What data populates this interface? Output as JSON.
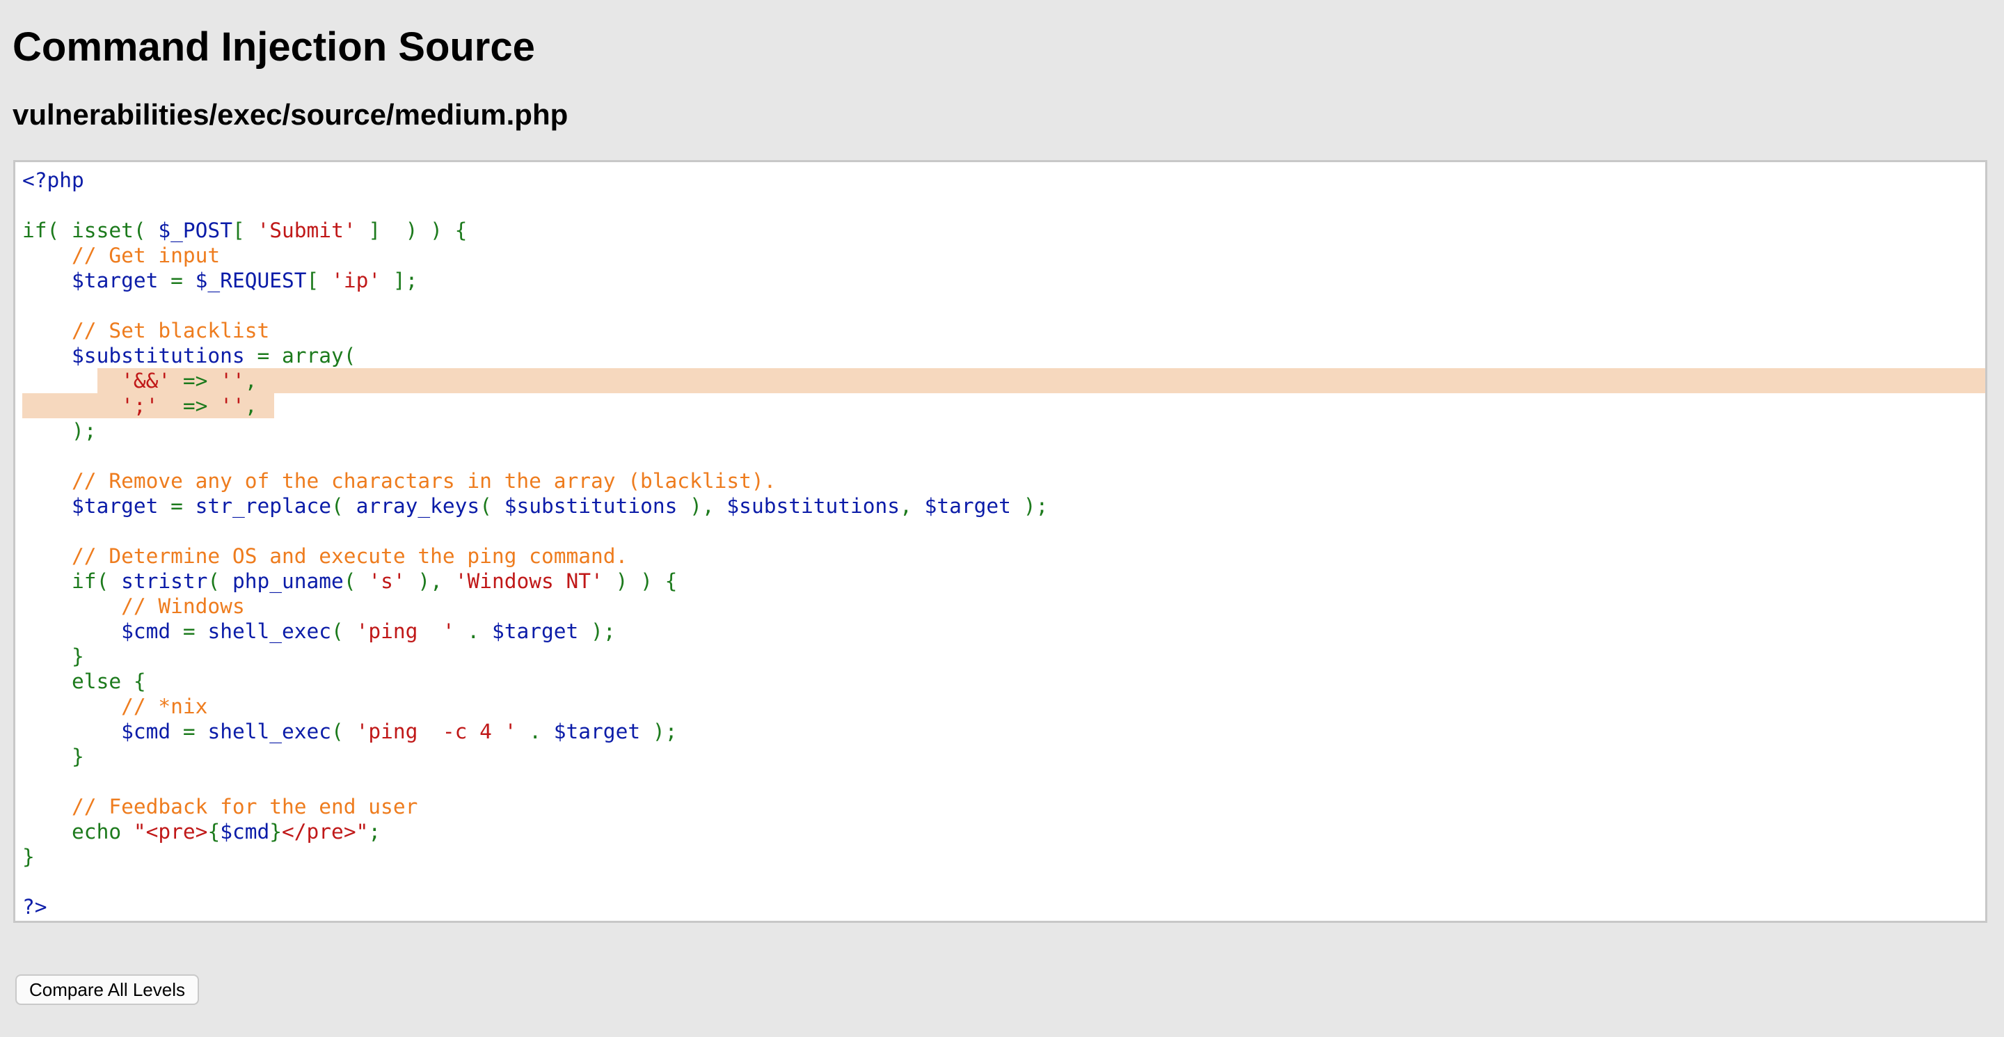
{
  "page": {
    "title": "Command Injection Source",
    "file_path": "vulnerabilities/exec/source/medium.php"
  },
  "code_lines": [
    [
      {
        "t": "<?php",
        "c": "v"
      }
    ],
    [],
    [
      {
        "t": "if( ",
        "c": "k"
      },
      {
        "t": "isset",
        "c": "k"
      },
      {
        "t": "( ",
        "c": "k"
      },
      {
        "t": "$_POST",
        "c": "v"
      },
      {
        "t": "[ ",
        "c": "k"
      },
      {
        "t": "'Submit'",
        "c": "s"
      },
      {
        "t": " ]  ) ) {",
        "c": "k"
      }
    ],
    [
      {
        "t": "    ",
        "c": "k"
      },
      {
        "t": "// Get input",
        "c": "c"
      }
    ],
    [
      {
        "t": "    ",
        "c": "k"
      },
      {
        "t": "$target",
        "c": "v"
      },
      {
        "t": " = ",
        "c": "k"
      },
      {
        "t": "$_REQUEST",
        "c": "v"
      },
      {
        "t": "[ ",
        "c": "k"
      },
      {
        "t": "'ip'",
        "c": "s"
      },
      {
        "t": " ];",
        "c": "k"
      }
    ],
    [],
    [
      {
        "t": "    ",
        "c": "k"
      },
      {
        "t": "// Set blacklist",
        "c": "c"
      }
    ],
    [
      {
        "t": "    ",
        "c": "k"
      },
      {
        "t": "$substitutions",
        "c": "v"
      },
      {
        "t": " = array(",
        "c": "k"
      }
    ],
    [
      {
        "t": "        ",
        "c": "k"
      },
      {
        "t": "'&&'",
        "c": "s"
      },
      {
        "t": " => ",
        "c": "k"
      },
      {
        "t": "''",
        "c": "s"
      },
      {
        "t": ",",
        "c": "k"
      }
    ],
    [
      {
        "t": "        ",
        "c": "k"
      },
      {
        "t": "';'",
        "c": "s"
      },
      {
        "t": "  => ",
        "c": "k"
      },
      {
        "t": "''",
        "c": "s"
      },
      {
        "t": ",",
        "c": "k"
      }
    ],
    [
      {
        "t": "    );",
        "c": "k"
      }
    ],
    [],
    [
      {
        "t": "    ",
        "c": "k"
      },
      {
        "t": "// Remove any of the charactars in the array (blacklist).",
        "c": "c"
      }
    ],
    [
      {
        "t": "    ",
        "c": "k"
      },
      {
        "t": "$target",
        "c": "v"
      },
      {
        "t": " = ",
        "c": "k"
      },
      {
        "t": "str_replace",
        "c": "v"
      },
      {
        "t": "( ",
        "c": "k"
      },
      {
        "t": "array_keys",
        "c": "v"
      },
      {
        "t": "( ",
        "c": "k"
      },
      {
        "t": "$substitutions",
        "c": "v"
      },
      {
        "t": " ), ",
        "c": "k"
      },
      {
        "t": "$substitutions",
        "c": "v"
      },
      {
        "t": ", ",
        "c": "k"
      },
      {
        "t": "$target",
        "c": "v"
      },
      {
        "t": " );",
        "c": "k"
      }
    ],
    [],
    [
      {
        "t": "    ",
        "c": "k"
      },
      {
        "t": "// Determine OS and execute the ping command.",
        "c": "c"
      }
    ],
    [
      {
        "t": "    if( ",
        "c": "k"
      },
      {
        "t": "stristr",
        "c": "v"
      },
      {
        "t": "( ",
        "c": "k"
      },
      {
        "t": "php_uname",
        "c": "v"
      },
      {
        "t": "( ",
        "c": "k"
      },
      {
        "t": "'s'",
        "c": "s"
      },
      {
        "t": " ), ",
        "c": "k"
      },
      {
        "t": "'Windows NT'",
        "c": "s"
      },
      {
        "t": " ) ) {",
        "c": "k"
      }
    ],
    [
      {
        "t": "        ",
        "c": "k"
      },
      {
        "t": "// Windows",
        "c": "c"
      }
    ],
    [
      {
        "t": "        ",
        "c": "k"
      },
      {
        "t": "$cmd",
        "c": "v"
      },
      {
        "t": " = ",
        "c": "k"
      },
      {
        "t": "shell_exec",
        "c": "v"
      },
      {
        "t": "( ",
        "c": "k"
      },
      {
        "t": "'ping  '",
        "c": "s"
      },
      {
        "t": " . ",
        "c": "k"
      },
      {
        "t": "$target",
        "c": "v"
      },
      {
        "t": " );",
        "c": "k"
      }
    ],
    [
      {
        "t": "    }",
        "c": "k"
      }
    ],
    [
      {
        "t": "    else {",
        "c": "k"
      }
    ],
    [
      {
        "t": "        ",
        "c": "k"
      },
      {
        "t": "// *nix",
        "c": "c"
      }
    ],
    [
      {
        "t": "        ",
        "c": "k"
      },
      {
        "t": "$cmd",
        "c": "v"
      },
      {
        "t": " = ",
        "c": "k"
      },
      {
        "t": "shell_exec",
        "c": "v"
      },
      {
        "t": "( ",
        "c": "k"
      },
      {
        "t": "'ping  -c 4 '",
        "c": "s"
      },
      {
        "t": " . ",
        "c": "k"
      },
      {
        "t": "$target",
        "c": "v"
      },
      {
        "t": " );",
        "c": "k"
      }
    ],
    [
      {
        "t": "    }",
        "c": "k"
      }
    ],
    [],
    [
      {
        "t": "    ",
        "c": "k"
      },
      {
        "t": "// Feedback for the end user",
        "c": "c"
      }
    ],
    [
      {
        "t": "    echo ",
        "c": "k"
      },
      {
        "t": "\"<pre>",
        "c": "s"
      },
      {
        "t": "{",
        "c": "k"
      },
      {
        "t": "$cmd",
        "c": "v"
      },
      {
        "t": "}",
        "c": "k"
      },
      {
        "t": "</pre>\"",
        "c": "s"
      },
      {
        "t": ";",
        "c": "k"
      }
    ],
    [
      {
        "t": "}",
        "c": "k"
      }
    ],
    [],
    [
      {
        "t": "?>",
        "c": "v"
      }
    ]
  ],
  "highlight": {
    "lines": [
      8,
      9
    ],
    "color": "#f6d8be"
  },
  "syntax_colors": {
    "keyword": "#1c7a1c",
    "variable": "#0b1ca8",
    "string": "#c01818",
    "comment": "#ee7c1e"
  },
  "buttons": {
    "compare_label": "Compare All Levels"
  }
}
